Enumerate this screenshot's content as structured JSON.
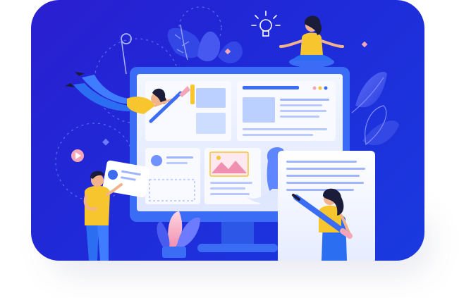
{
  "scene": {
    "kind": "illustration",
    "colors": {
      "background": "#1f2ad8",
      "monitor_frame": "#3b6cf5",
      "monitor_screen": "#eef3ff",
      "accent_yellow": "#f7c62f",
      "accent_pink": "#f5a5b8",
      "accent_cyan": "#5ec8ff",
      "skin": "#f2b28c",
      "hair": "#1b1c3a",
      "pants": "#2b6ef2"
    },
    "icons": [
      "lightbulb-icon",
      "play-icon",
      "image-icon",
      "pencil-icon",
      "paintbrush-icon"
    ]
  }
}
